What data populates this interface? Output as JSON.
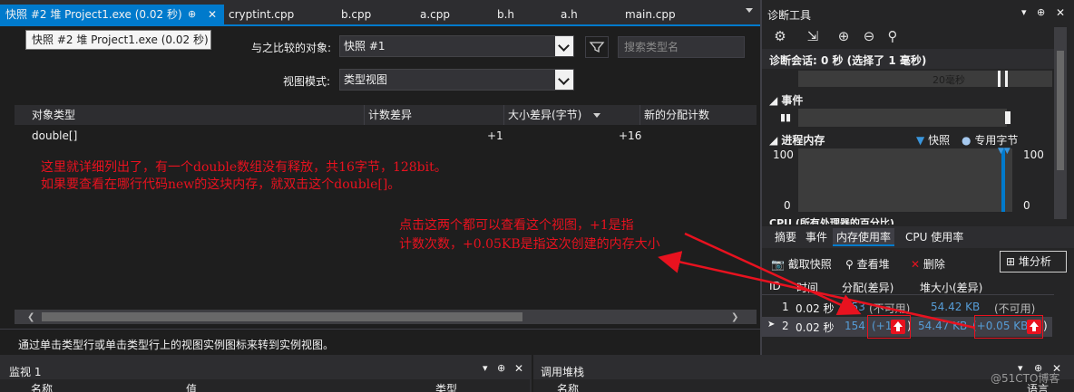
{
  "tabs": {
    "active": "快照 #2 堆 Project1.exe (0.02 秒)",
    "active_pin": "⊕",
    "active_close": "✕",
    "others": [
      "cryptint.cpp",
      "b.cpp",
      "a.cpp",
      "b.h",
      "a.h",
      "main.cpp"
    ]
  },
  "snapshot": {
    "tooltip": "快照 #2 堆 Project1.exe (0.02 秒)",
    "compare_label": "与之比较的对象:",
    "compare_value": "快照 #1",
    "search_placeholder": "搜索类型名",
    "view_mode_label": "视图模式:",
    "view_mode_value": "类型视图",
    "columns": [
      "对象类型",
      "计数差异",
      "大小差异(字节)",
      "新的分配计数"
    ],
    "rows": [
      {
        "type": "double[]",
        "count_diff": "+1",
        "size_diff": "+16"
      }
    ],
    "status_text": "通过单击类型行或单击类型行上的视图实例图标来转到实例视图。"
  },
  "annotations": {
    "line1": "这里就详细列出了，有一个double数组没有释放，共16字节，128bit。",
    "line2": "如果要查看在哪行代码new的这块内存，就双击这个double[]。",
    "line3": "点击这两个都可以查看这个视图，+1是指",
    "line4": "计数次数，+0.05KB是指这次创建的内存大小",
    "color": "#e8121f"
  },
  "diagnostics": {
    "title": "诊断工具",
    "session": "诊断会话: 0 秒 (选择了 1 毫秒)",
    "timeline_label": "20毫秒",
    "events_section": "事件",
    "memory_section": "进程内存",
    "legend_snapshot": "快照",
    "legend_private": "专用字节",
    "axis_max_left": "100",
    "axis_min_left": "0",
    "axis_max_right": "100",
    "axis_min_right": "0",
    "cpu_section_partial": "CPU (所有处理器的百分比)",
    "tabs": [
      "摘要",
      "事件",
      "内存使用率",
      "CPU 使用率"
    ],
    "toolbar": {
      "take_snapshot": "截取快照",
      "view_heap": "查看堆",
      "delete": "删除",
      "heap_analysis": "堆分析"
    },
    "grid_headers": [
      "ID",
      "时间",
      "分配(差异)",
      "堆大小(差异)"
    ],
    "grid_rows": [
      {
        "id": "1",
        "time": "0.02 秒",
        "alloc": "153",
        "alloc_diff": "(不可用)",
        "heap": "54.42 KB",
        "heap_diff": "(不可用)"
      },
      {
        "id": "2",
        "time": "0.02 秒",
        "alloc": "154",
        "alloc_diff": "(+1",
        "heap": "54.47 KB",
        "heap_diff": "(+0.05 KB"
      }
    ]
  },
  "watch": {
    "title": "监视 1",
    "columns": [
      "名称",
      "值",
      "类型"
    ]
  },
  "callstack": {
    "title": "调用堆栈",
    "columns": [
      "名称",
      "语言"
    ]
  },
  "watermark": "@51CTO博客"
}
